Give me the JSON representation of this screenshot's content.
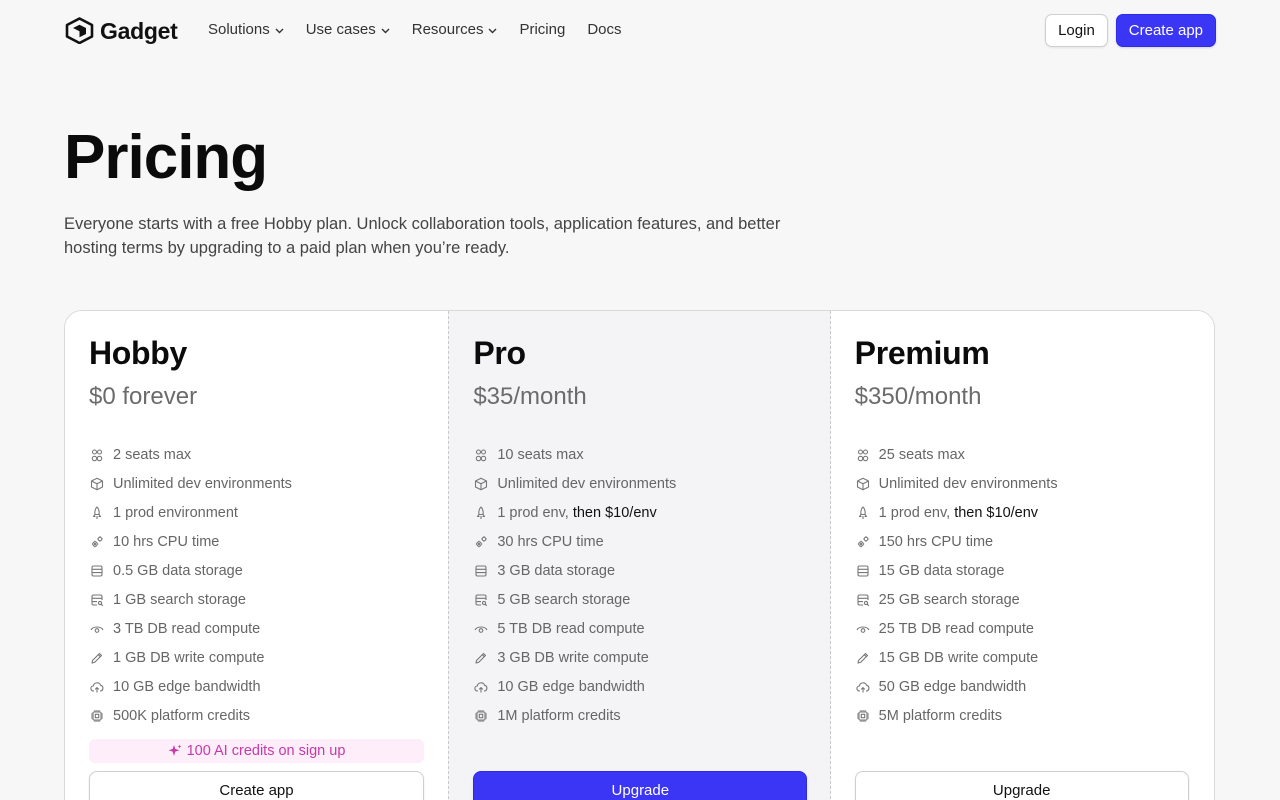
{
  "nav": {
    "logo_text": "Gadget",
    "links": [
      {
        "label": "Solutions",
        "has_dropdown": true
      },
      {
        "label": "Use cases",
        "has_dropdown": true
      },
      {
        "label": "Resources",
        "has_dropdown": true
      },
      {
        "label": "Pricing",
        "has_dropdown": false
      },
      {
        "label": "Docs",
        "has_dropdown": false
      }
    ],
    "login_label": "Login",
    "create_label": "Create app"
  },
  "hero": {
    "title": "Pricing",
    "subtitle": "Everyone starts with a free Hobby plan. Unlock collaboration tools, application features, and better hosting terms by upgrading to a paid plan when you’re ready."
  },
  "colors": {
    "accent": "#3b35f5",
    "ai_badge_bg": "#fdeefa",
    "ai_badge_text": "#c53aa9",
    "pro_bg": "#f4f4f6"
  },
  "plans": [
    {
      "name": "Hobby",
      "price": "$0 forever",
      "features": [
        {
          "icon": "seats-icon",
          "text": "2 seats max",
          "extra": ""
        },
        {
          "icon": "cube-icon",
          "text": "Unlimited dev environments",
          "extra": ""
        },
        {
          "icon": "rocket-icon",
          "text": "1 prod environment",
          "extra": ""
        },
        {
          "icon": "cpu-gears-icon",
          "text": "10 hrs CPU time",
          "extra": ""
        },
        {
          "icon": "database-icon",
          "text": "0.5 GB data storage",
          "extra": ""
        },
        {
          "icon": "search-storage-icon",
          "text": "1 GB search storage",
          "extra": ""
        },
        {
          "icon": "eye-icon",
          "text": "3 TB DB read compute",
          "extra": ""
        },
        {
          "icon": "pencil-icon",
          "text": "1 GB DB write compute",
          "extra": ""
        },
        {
          "icon": "cloud-upload-icon",
          "text": "10 GB edge bandwidth",
          "extra": ""
        },
        {
          "icon": "chip-icon",
          "text": "500K platform credits",
          "extra": ""
        }
      ],
      "badge": "100 AI credits on sign up",
      "button": "Create app"
    },
    {
      "name": "Pro",
      "price": "$35/month",
      "features": [
        {
          "icon": "seats-icon",
          "text": "10 seats max",
          "extra": ""
        },
        {
          "icon": "cube-icon",
          "text": "Unlimited dev environments",
          "extra": ""
        },
        {
          "icon": "rocket-icon",
          "text": "1 prod env, ",
          "extra": "then $10/env"
        },
        {
          "icon": "cpu-gears-icon",
          "text": "30 hrs CPU time",
          "extra": ""
        },
        {
          "icon": "database-icon",
          "text": "3 GB data storage",
          "extra": ""
        },
        {
          "icon": "search-storage-icon",
          "text": "5 GB search storage",
          "extra": ""
        },
        {
          "icon": "eye-icon",
          "text": "5 TB DB read compute",
          "extra": ""
        },
        {
          "icon": "pencil-icon",
          "text": "3 GB DB write compute",
          "extra": ""
        },
        {
          "icon": "cloud-upload-icon",
          "text": "10 GB edge bandwidth",
          "extra": ""
        },
        {
          "icon": "chip-icon",
          "text": "1M platform credits",
          "extra": ""
        }
      ],
      "badge": "",
      "button": "Upgrade"
    },
    {
      "name": "Premium",
      "price": "$350/month",
      "features": [
        {
          "icon": "seats-icon",
          "text": "25 seats max",
          "extra": ""
        },
        {
          "icon": "cube-icon",
          "text": "Unlimited dev environments",
          "extra": ""
        },
        {
          "icon": "rocket-icon",
          "text": "1 prod env, ",
          "extra": "then $10/env"
        },
        {
          "icon": "cpu-gears-icon",
          "text": "150 hrs CPU time",
          "extra": ""
        },
        {
          "icon": "database-icon",
          "text": "15 GB data storage",
          "extra": ""
        },
        {
          "icon": "search-storage-icon",
          "text": "25 GB search storage",
          "extra": ""
        },
        {
          "icon": "eye-icon",
          "text": "25 TB DB read compute",
          "extra": ""
        },
        {
          "icon": "pencil-icon",
          "text": "15 GB DB write compute",
          "extra": ""
        },
        {
          "icon": "cloud-upload-icon",
          "text": "50 GB edge bandwidth",
          "extra": ""
        },
        {
          "icon": "chip-icon",
          "text": "5M platform credits",
          "extra": ""
        }
      ],
      "badge": "",
      "button": "Upgrade"
    }
  ]
}
